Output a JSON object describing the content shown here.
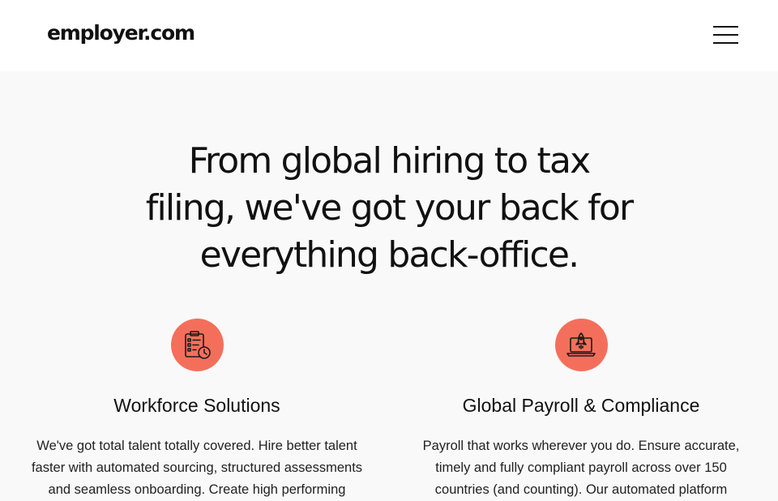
{
  "header": {
    "logo_text": "employer.com",
    "menu_icon": "hamburger-menu-icon"
  },
  "hero": {
    "line1": "From global hiring to tax",
    "line2": "filing, we've got your back for",
    "line3": "everything back-office."
  },
  "features": [
    {
      "icon": "clipboard-checklist-clock-icon",
      "title": "Workforce Solutions",
      "description_lines": [
        "We've got total talent totally covered. Hire better talent",
        "faster with automated sourcing, structured assessments",
        "and seamless onboarding. Create high performing"
      ]
    },
    {
      "icon": "laptop-rocket-icon",
      "title": "Global Payroll & Compliance",
      "description_lines": [
        "Payroll that works wherever you do. Ensure accurate,",
        "timely and fully compliant payroll across over 150",
        "countries (and counting). Our automated platform"
      ]
    }
  ],
  "colors": {
    "accent": "#f46f5b",
    "background": "#f9f9f9",
    "header_background": "#ffffff",
    "text": "#111111"
  }
}
